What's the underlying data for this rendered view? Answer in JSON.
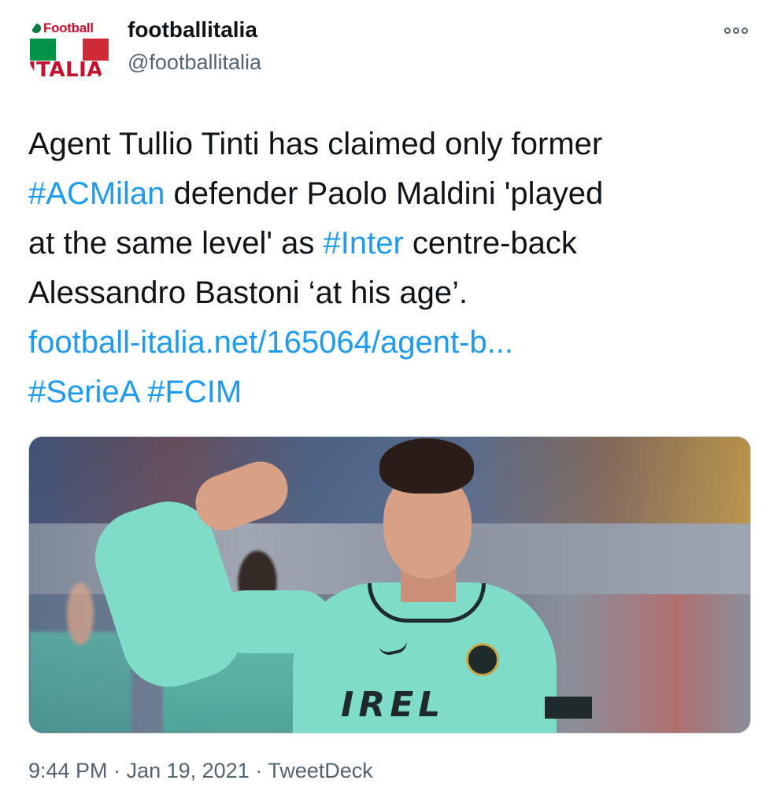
{
  "author": {
    "display_name": "footballitalia",
    "handle": "@footballitalia",
    "avatar": {
      "logo_top": "Football",
      "logo_bottom": "ITALIA",
      "flag_colors": [
        "#009246",
        "#ffffff",
        "#ce2b37"
      ]
    }
  },
  "more_icon": "more-options-icon",
  "tweet": {
    "line1": "Agent Tullio Tinti has claimed only former",
    "line2_tag": "#ACMilan",
    "line2_rest": " defender Paolo Maldini 'played",
    "line3_pre": "at the same level' as ",
    "line3_tag": "#Inter",
    "line3_post": " centre-back",
    "line4": "Alessandro Bastoni ‘at his age’.",
    "link": "football-italia.net/165064/agent-b...",
    "tag_seriea": "#SerieA",
    "tag_fcim": "#FCIM"
  },
  "media": {
    "sponsor_text": "IREL"
  },
  "meta": {
    "time": "9:44 PM",
    "separator": " · ",
    "date": "Jan 19, 2021",
    "source": "TweetDeck"
  },
  "colors": {
    "link": "#1d9bf0",
    "text": "#0f1419",
    "secondary": "#536471"
  }
}
